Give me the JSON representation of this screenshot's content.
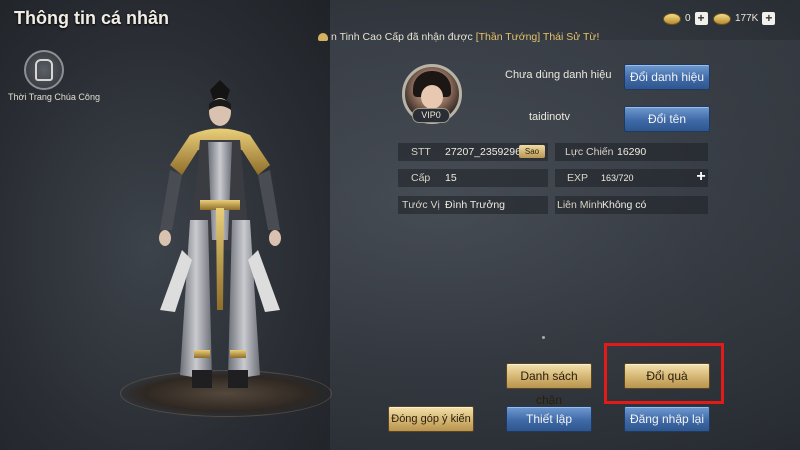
{
  "header": {
    "title": "Thông tin cá nhân"
  },
  "ticker": {
    "prefix": "n Tinh Cao Cấp đã nhận được ",
    "item": "[Thần Tướng] Thái Sử Từ!"
  },
  "currency": [
    {
      "icon": "ingot-icon",
      "value": "0"
    },
    {
      "icon": "gold-coin-icon",
      "value": "177K"
    }
  ],
  "outfit": {
    "label": "Thời Trang Chúa Công"
  },
  "profile": {
    "vip": "VIP0",
    "title_status": "Chưa dùng danh hiệu",
    "player_name": "taidinotv",
    "change_title_label": "Đổi danh hiệu",
    "rename_label": "Đổi tên"
  },
  "stats": {
    "stt_label": "STT",
    "stt_value": "27207_2359296",
    "copy_label": "Sao",
    "power_label": "Lực Chiến",
    "power_value": "16290",
    "level_label": "Cấp",
    "level_value": "15",
    "exp_label": "EXP",
    "exp_value": "163/720",
    "rank_label": "Tước Vị",
    "rank_value": "Đình Trưởng",
    "alliance_label": "Liên Minh",
    "alliance_value": "Không có"
  },
  "buttons": {
    "blocklist": "Danh sách chặn",
    "redeem": "Đổi quà",
    "feedback": "Đóng góp ý kiến",
    "settings": "Thiết lập",
    "relogin": "Đăng nhập lại"
  },
  "colors": {
    "highlight": "#e11a1a",
    "gold_button": "#d4b572",
    "blue_button": "#3f6aa8"
  }
}
